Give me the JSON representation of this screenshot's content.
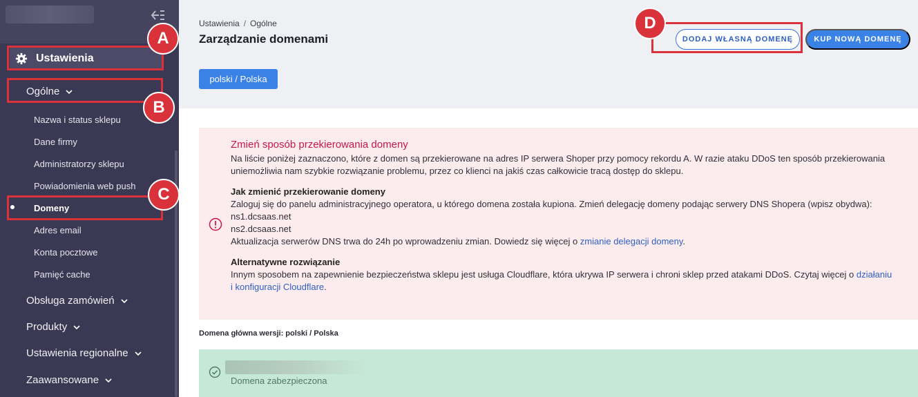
{
  "sidebar": {
    "collapse_icon": "collapse-left-icon",
    "section": {
      "label": "Ustawienia",
      "icon": "gear-icon"
    },
    "groups": [
      {
        "label": "Ogólne"
      },
      {
        "label": "Obsługa zamówień"
      },
      {
        "label": "Produkty"
      },
      {
        "label": "Ustawienia regionalne"
      },
      {
        "label": "Zaawansowane"
      }
    ],
    "sub_items": [
      {
        "label": "Nazwa i status sklepu"
      },
      {
        "label": "Dane firmy"
      },
      {
        "label": "Administratorzy sklepu"
      },
      {
        "label": "Powiadomienia web push"
      },
      {
        "label": "Domeny"
      },
      {
        "label": "Adres email"
      },
      {
        "label": "Konta pocztowe"
      },
      {
        "label": "Pamięć cache"
      }
    ]
  },
  "callouts": {
    "a": "A",
    "b": "B",
    "c": "C",
    "d": "D"
  },
  "header": {
    "breadcrumb": [
      "Ustawienia",
      "/",
      "Ogólne"
    ],
    "title": "Zarządzanie domenami",
    "language_button": "polski / Polska",
    "add_domain_button": "DODAJ WŁASNĄ DOMENĘ",
    "buy_domain_button": "KUP NOWĄ DOMENĘ"
  },
  "alert": {
    "title": "Zmień sposób przekierowania domeny",
    "intro": "Na liście poniżej zaznaczono, które z domen są przekierowane na adres IP serwera Shoper przy pomocy rekordu A. W razie ataku DDoS ten sposób przekierowania uniemożliwia nam szybkie rozwiązanie problemu, przez co klienci na jakiś czas całkowicie tracą dostęp do sklepu.",
    "how_heading": "Jak zmienić przekierowanie domeny",
    "how_text": "Zaloguj się do panelu administracyjnego operatora, u którego domena została kupiona. Zmień delegację domeny podając serwery DNS Shopera (wpisz obydwa):",
    "ns1": "ns1.dcsaas.net",
    "ns2": "ns2.dcsaas.net",
    "update_text": "Aktualizacja serwerów DNS trwa do 24h po wprowadzeniu zmian. Dowiedz się więcej o ",
    "update_link": "zmianie delegacji domeny",
    "update_end": ".",
    "alt_heading": "Alternatywne rozwiązanie",
    "alt_text": "Innym sposobem na zapewnienie bezpieczeństwa sklepu jest usługa Cloudflare, która ukrywa IP serwera i chroni sklep przed atakami DDoS. Czytaj więcej o ",
    "alt_link": "działaniu i konfiguracji Cloudflare",
    "alt_end": "."
  },
  "domain_section": {
    "label": "Domena główna wersji: polski / Polska",
    "status": "Domena zabezpieczona"
  },
  "colors": {
    "sidebar": "#3a3852",
    "accent": "#3b82e6",
    "callout": "#d9323a",
    "alert_bg": "#fdeced",
    "alert_title": "#c8174b",
    "success_bg": "#c6e8d7"
  }
}
